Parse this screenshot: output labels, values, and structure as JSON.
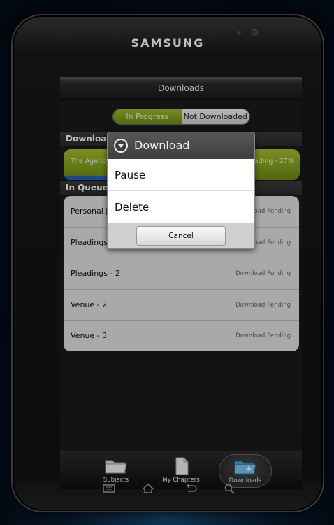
{
  "device": {
    "brand": "SAMSUNG"
  },
  "header": {
    "title": "Downloads"
  },
  "segmented": {
    "in_progress": "In Progress",
    "not_downloaded": "Not Downloaded"
  },
  "downloading": {
    "section_label": "Downloading",
    "item": {
      "name": "The Agency",
      "status": "Downloading - 27%",
      "progress": 0.27
    }
  },
  "queue": {
    "section_label": "In Queue",
    "items": [
      {
        "name": "Personal Jurisdiction",
        "status": "Download Pending"
      },
      {
        "name": "Pleadings - 1",
        "status": "Download Pending"
      },
      {
        "name": "Pleadings - 2",
        "status": "Download Pending"
      },
      {
        "name": "Venue - 2",
        "status": "Download Pending"
      },
      {
        "name": "Venue - 3",
        "status": "Download Pending"
      }
    ]
  },
  "tabs": [
    {
      "label": "Subjects",
      "icon": "folder-icon"
    },
    {
      "label": "My Chapters",
      "icon": "document-icon"
    },
    {
      "label": "Downloads",
      "icon": "download-folder-icon"
    }
  ],
  "dialog": {
    "title": "Download",
    "options": [
      "Pause",
      "Delete"
    ],
    "cancel_label": "Cancel"
  },
  "colors": {
    "accent_green": "#8aa61f",
    "progress_blue": "#1f63c9"
  }
}
